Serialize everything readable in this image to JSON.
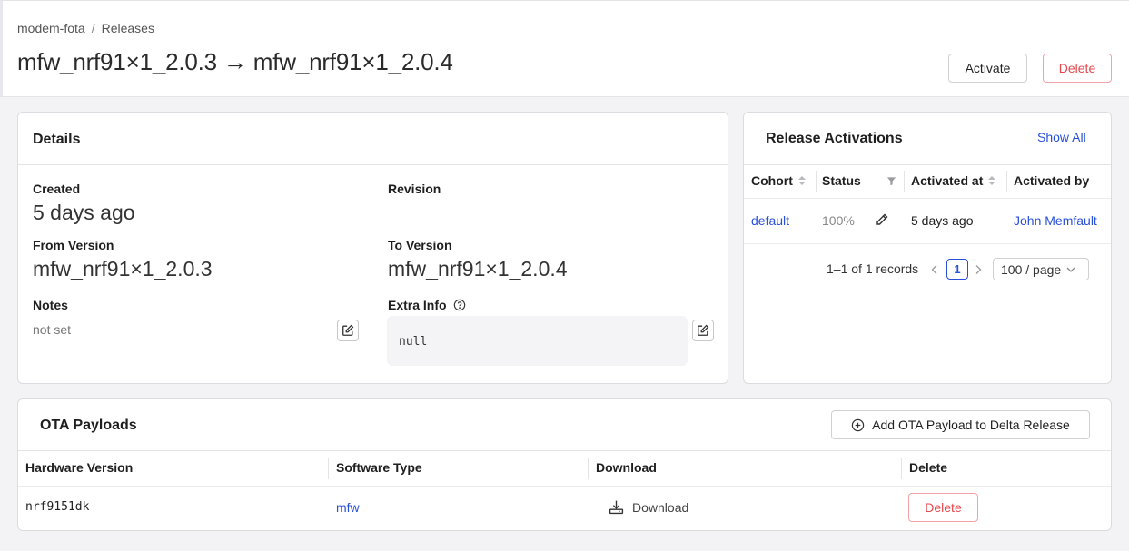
{
  "breadcrumb": {
    "project": "modem-fota",
    "separator": "/",
    "section": "Releases"
  },
  "page": {
    "title": "mfw_nrf91×1_2.0.3 → mfw_nrf91×1_2.0.4"
  },
  "actions": {
    "activate": "Activate",
    "delete": "Delete"
  },
  "details": {
    "title": "Details",
    "created_label": "Created",
    "created_value": "5 days ago",
    "revision_label": "Revision",
    "from_label": "From Version",
    "from_value": "mfw_nrf91×1_2.0.3",
    "to_label": "To Version",
    "to_value": "mfw_nrf91×1_2.0.4",
    "notes_label": "Notes",
    "notes_value": "not set",
    "extra_label": "Extra Info",
    "extra_value": "null"
  },
  "activations": {
    "title": "Release Activations",
    "show_all": "Show All",
    "columns": {
      "cohort": "Cohort",
      "status": "Status",
      "activated_at": "Activated at",
      "activated_by": "Activated by"
    },
    "rows": [
      {
        "cohort": "default",
        "status": "100%",
        "activated_at": "5 days ago",
        "activated_by": "John Memfault"
      }
    ],
    "pagination": {
      "summary": "1–1 of 1 records",
      "current_page": "1",
      "page_size": "100 / page"
    }
  },
  "payloads": {
    "title": "OTA Payloads",
    "add_button": "Add OTA Payload to Delta Release",
    "columns": {
      "hardware": "Hardware Version",
      "software": "Software Type",
      "download": "Download",
      "delete": "Delete"
    },
    "rows": [
      {
        "hardware": "nrf9151dk",
        "software": "mfw",
        "download": "Download",
        "delete": "Delete"
      }
    ]
  },
  "colors": {
    "link": "#2950da",
    "danger": "#e5484d",
    "border": "#dcdce0"
  }
}
